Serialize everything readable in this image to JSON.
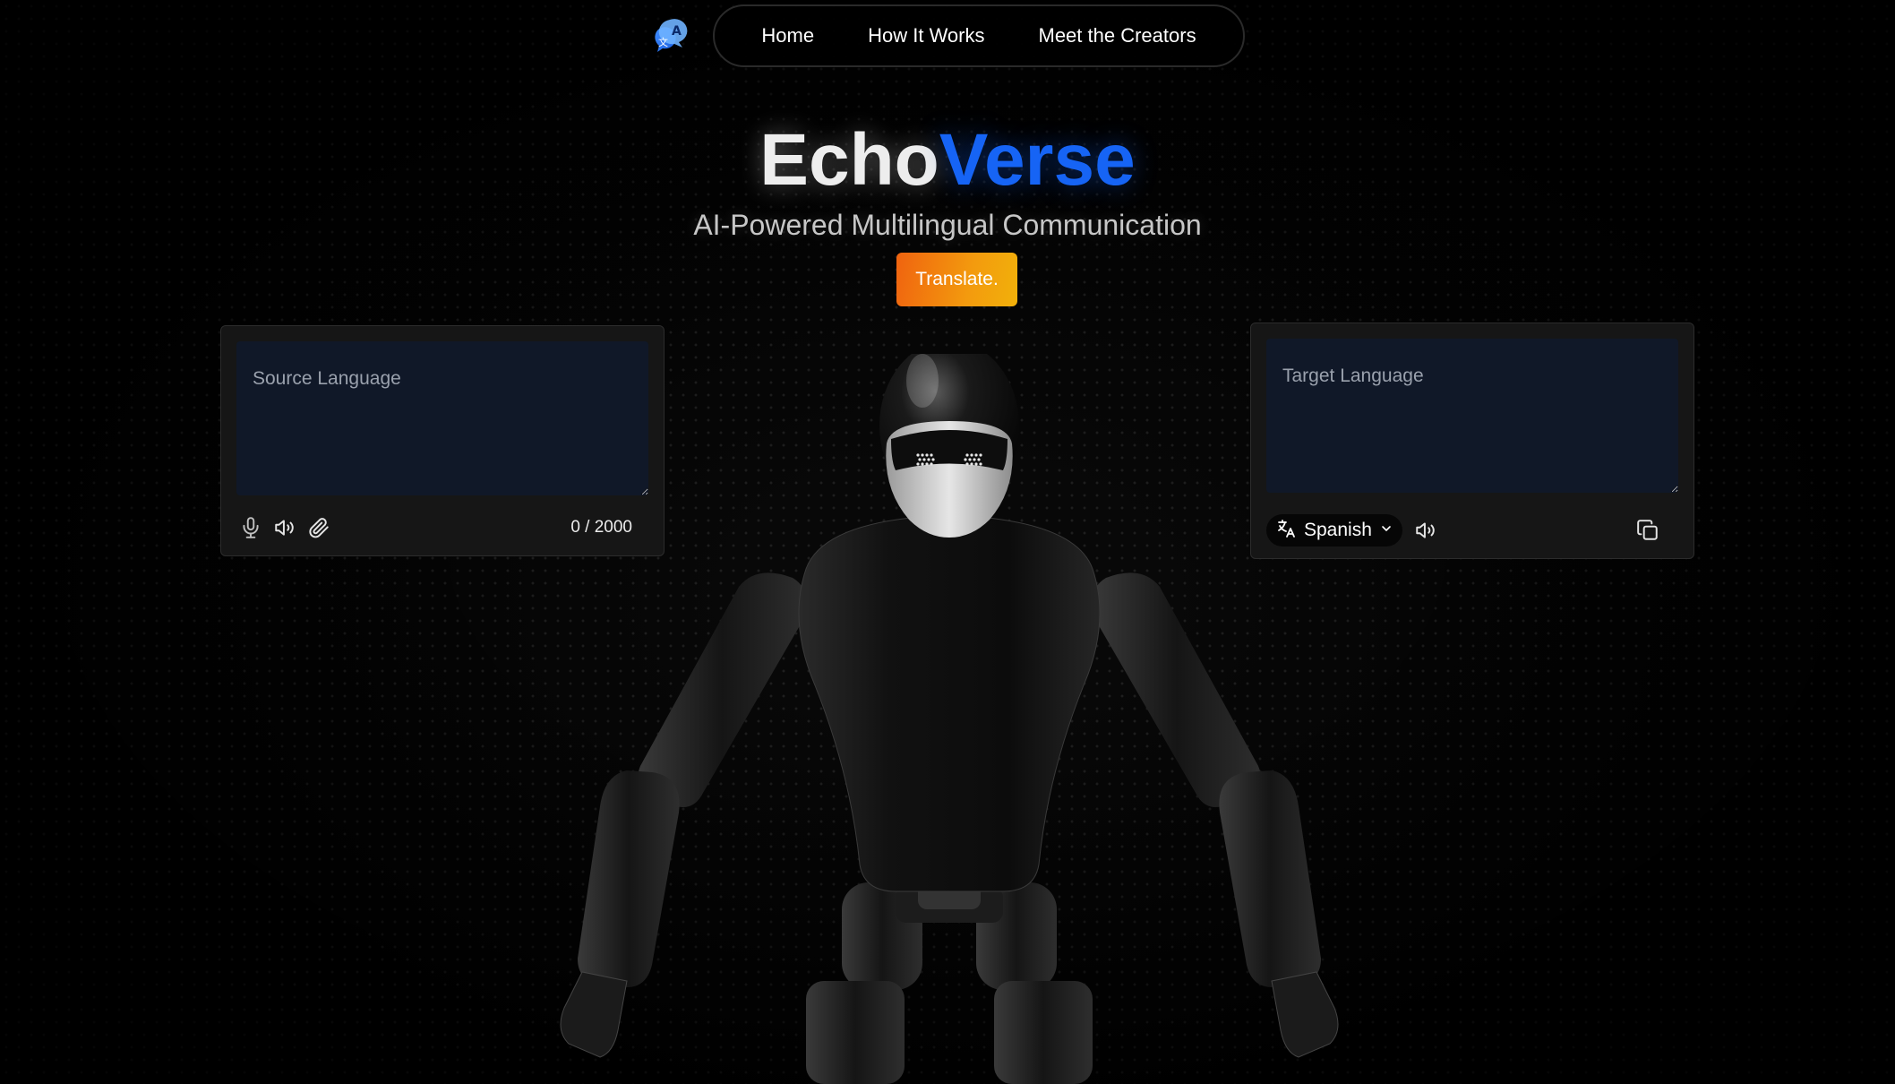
{
  "nav": {
    "items": [
      {
        "label": "Home"
      },
      {
        "label": "How It Works"
      },
      {
        "label": "Meet the Creators"
      }
    ]
  },
  "hero": {
    "title_part1": "Echo",
    "title_part2": "Verse",
    "subtitle": "AI-Powered Multilingual Communication",
    "translate_label": "Translate."
  },
  "source": {
    "placeholder": "Source Language",
    "counter": "0 / 2000"
  },
  "target": {
    "placeholder": "Target Language",
    "language": "Spanish"
  },
  "colors": {
    "accent_blue": "#1664f5",
    "button_orange": "#f0630f",
    "button_yellow": "#f2b10a",
    "textarea_bg": "#101828"
  },
  "icons": [
    "translate-logo-icon",
    "microphone-icon",
    "speaker-icon",
    "paperclip-icon",
    "translate-icon",
    "chevron-down-icon",
    "copy-icon"
  ]
}
